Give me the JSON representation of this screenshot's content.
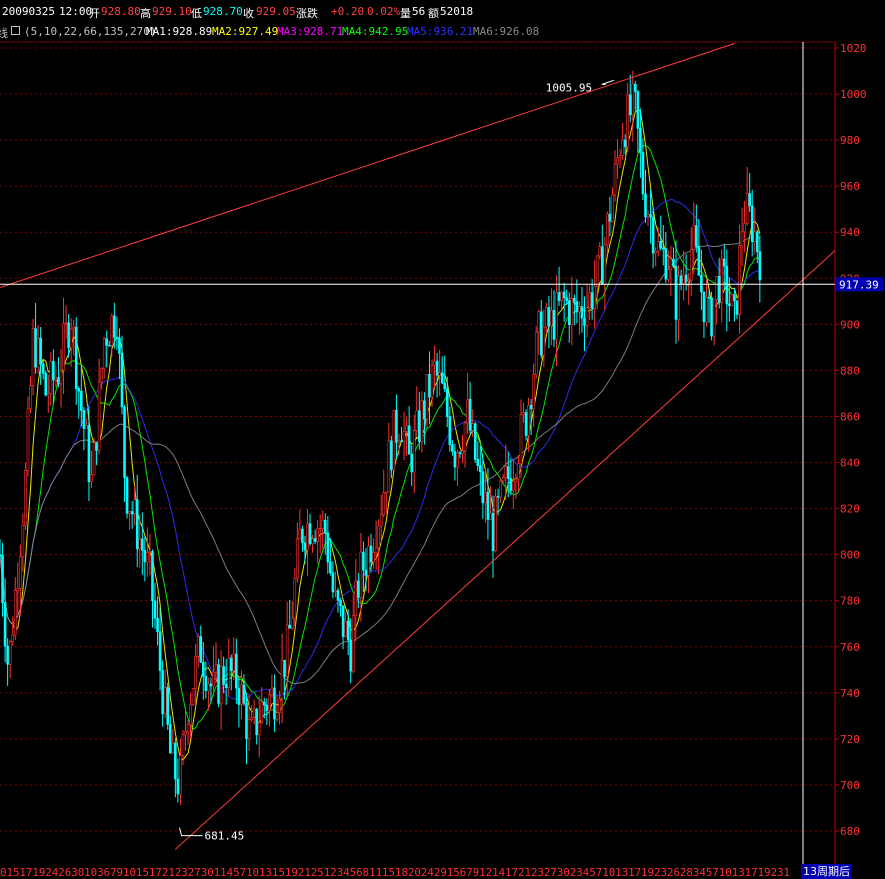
{
  "header": {
    "date": "20090325",
    "time": "12:00",
    "open_label": "开",
    "open": "928.80",
    "high_label": "高",
    "high": "929.10",
    "low_label": "低",
    "low": "928.70",
    "close_label": "收",
    "close": "929.05",
    "change_label": "涨跌",
    "change": "+0.20",
    "change_pct": "0.02%",
    "volume_label": "量",
    "volume": "56",
    "amount_label": "额",
    "amount": "52018"
  },
  "ma_row": {
    "prefix": "线",
    "toggle_icon": "collapse-box-icon",
    "params": "(5,10,22,66,135,270)",
    "items": [
      {
        "label": "MA1:928.89",
        "color": "#ffffff"
      },
      {
        "label": "MA2:927.49",
        "color": "#ffff00"
      },
      {
        "label": "MA3:928.71",
        "color": "#ff00ff"
      },
      {
        "label": "MA4:942.95",
        "color": "#00ff00"
      },
      {
        "label": "MA5:936.21",
        "color": "#3030ff"
      },
      {
        "label": "MA6:926.08",
        "color": "#8a8a8a"
      }
    ]
  },
  "colors": {
    "up": "#ff3232",
    "down": "#00ffff",
    "trend": "#ff3c3c",
    "grid": "#800000",
    "axis": "#c00000",
    "crosshair": "#ffffff",
    "price_tag_bg": "#0000b0"
  },
  "chart_data": {
    "type": "candlestick",
    "ylim": [
      672,
      1022
    ],
    "y_ticks": [
      "680",
      "700",
      "720",
      "740",
      "760",
      "780",
      "800",
      "820",
      "840",
      "860",
      "880",
      "900",
      "920",
      "940",
      "960",
      "980",
      "1000",
      "1020"
    ],
    "x_tick_text": "01517192426301036791015172123273011457101315192125123456811151820242915679121417212327302345710131719232628345710131719231",
    "period_label": "13周期后",
    "cursor_value": "917.39",
    "annotations": [
      {
        "text": "1005.95",
        "value": 1005.95,
        "at": 0.735
      },
      {
        "text": "681.45",
        "value": 681.45,
        "at": 0.215
      }
    ],
    "trendlines": [
      {
        "from": [
          0.0,
          916
        ],
        "to": [
          0.88,
          1022
        ]
      },
      {
        "from": [
          0.21,
          672
        ],
        "to": [
          1.0,
          932
        ]
      }
    ],
    "price_path": [
      [
        0.0,
        800
      ],
      [
        0.01,
        750
      ],
      [
        0.02,
        790
      ],
      [
        0.03,
        830
      ],
      [
        0.04,
        895
      ],
      [
        0.055,
        870
      ],
      [
        0.07,
        880
      ],
      [
        0.085,
        905
      ],
      [
        0.095,
        870
      ],
      [
        0.11,
        830
      ],
      [
        0.125,
        895
      ],
      [
        0.14,
        905
      ],
      [
        0.15,
        830
      ],
      [
        0.165,
        810
      ],
      [
        0.18,
        790
      ],
      [
        0.195,
        740
      ],
      [
        0.205,
        710
      ],
      [
        0.215,
        700
      ],
      [
        0.225,
        735
      ],
      [
        0.24,
        760
      ],
      [
        0.255,
        740
      ],
      [
        0.27,
        750
      ],
      [
        0.285,
        745
      ],
      [
        0.3,
        720
      ],
      [
        0.315,
        735
      ],
      [
        0.33,
        740
      ],
      [
        0.345,
        760
      ],
      [
        0.36,
        810
      ],
      [
        0.375,
        815
      ],
      [
        0.39,
        810
      ],
      [
        0.4,
        780
      ],
      [
        0.41,
        770
      ],
      [
        0.42,
        760
      ],
      [
        0.43,
        790
      ],
      [
        0.44,
        800
      ],
      [
        0.455,
        820
      ],
      [
        0.47,
        850
      ],
      [
        0.48,
        860
      ],
      [
        0.49,
        840
      ],
      [
        0.505,
        860
      ],
      [
        0.52,
        880
      ],
      [
        0.53,
        870
      ],
      [
        0.545,
        845
      ],
      [
        0.56,
        860
      ],
      [
        0.575,
        830
      ],
      [
        0.59,
        810
      ],
      [
        0.605,
        830
      ],
      [
        0.615,
        840
      ],
      [
        0.63,
        860
      ],
      [
        0.645,
        895
      ],
      [
        0.66,
        900
      ],
      [
        0.675,
        910
      ],
      [
        0.69,
        905
      ],
      [
        0.705,
        910
      ],
      [
        0.72,
        925
      ],
      [
        0.735,
        960
      ],
      [
        0.745,
        985
      ],
      [
        0.76,
        995
      ],
      [
        0.77,
        960
      ],
      [
        0.78,
        945
      ],
      [
        0.79,
        930
      ],
      [
        0.8,
        930
      ],
      [
        0.81,
        910
      ],
      [
        0.82,
        925
      ],
      [
        0.83,
        935
      ],
      [
        0.84,
        915
      ],
      [
        0.85,
        900
      ],
      [
        0.86,
        920
      ],
      [
        0.87,
        915
      ],
      [
        0.88,
        900
      ],
      [
        0.89,
        950
      ],
      [
        0.9,
        945
      ],
      [
        0.91,
        930
      ]
    ]
  }
}
